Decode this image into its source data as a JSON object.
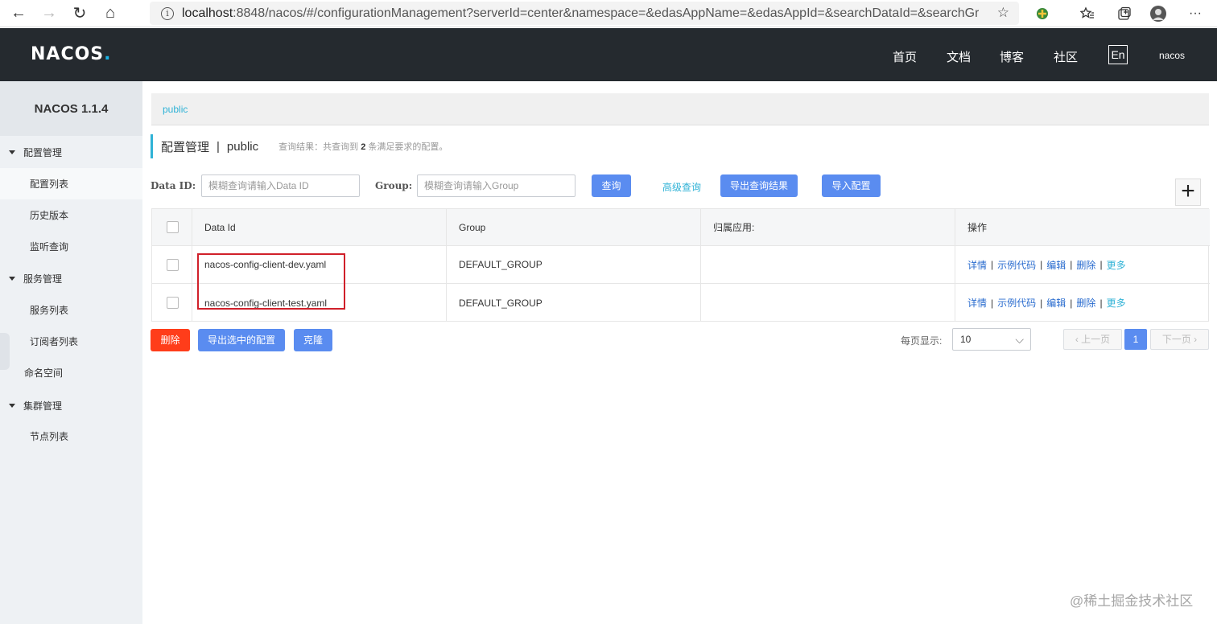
{
  "browser": {
    "url_host": "localhost",
    "url_rest": ":8848/nacos/#/configurationManagement?serverId=center&namespace=&edasAppName=&edasAppId=&searchDataId=&searchGr...",
    "back": "←",
    "forward": "→",
    "refresh": "↻",
    "home": "⌂",
    "star": "☆",
    "more": "···"
  },
  "header": {
    "logo_main": "NACOS",
    "logo_dot": ".",
    "nav": [
      "首页",
      "文档",
      "博客",
      "社区"
    ],
    "lang": "En",
    "user": "nacos"
  },
  "sidebar": {
    "title": "NACOS 1.1.4",
    "groups": [
      {
        "label": "配置管理",
        "items": [
          "配置列表",
          "历史版本",
          "监听查询"
        ]
      },
      {
        "label": "服务管理",
        "items": [
          "服务列表",
          "订阅者列表"
        ]
      },
      {
        "label": "命名空间"
      },
      {
        "label": "集群管理",
        "items": [
          "节点列表"
        ]
      }
    ]
  },
  "breadcrumb": "public",
  "page": {
    "title": "配置管理",
    "sep": "|",
    "namespace": "public",
    "result_prefix": "查询结果：共查询到",
    "result_count": "2",
    "result_suffix": "条满足要求的配置。"
  },
  "search": {
    "dataid_label": "Data ID:",
    "dataid_placeholder": "模糊查询请输入Data ID",
    "group_label": "Group:",
    "group_placeholder": "模糊查询请输入Group",
    "query": "查询",
    "advanced": "高级查询",
    "export_results": "导出查询结果",
    "import": "导入配置",
    "add": "+"
  },
  "table": {
    "columns": [
      "Data Id",
      "Group",
      "归属应用:",
      "操作"
    ],
    "rows": [
      {
        "data_id": "nacos-config-client-dev.yaml",
        "group": "DEFAULT_GROUP",
        "app": ""
      },
      {
        "data_id": "nacos-config-client-test.yaml",
        "group": "DEFAULT_GROUP",
        "app": ""
      }
    ],
    "ops": {
      "detail": "详情",
      "sample": "示例代码",
      "edit": "编辑",
      "delete": "删除",
      "more": "更多",
      "sep": "|"
    }
  },
  "footer": {
    "delete": "删除",
    "export_selected": "导出选中的配置",
    "clone": "克隆",
    "per_page_label": "每页显示:",
    "per_page_value": "10",
    "prev": "上一页",
    "current_page": "1",
    "next": "下一页"
  },
  "watermark": "@稀土掘金技术社区",
  "colors": {
    "header_bg": "#252a2f",
    "accent": "#2fb2d6",
    "primary_btn": "#5a8cf0",
    "danger_btn": "#ff3d1a",
    "highlight": "#d0202a"
  }
}
